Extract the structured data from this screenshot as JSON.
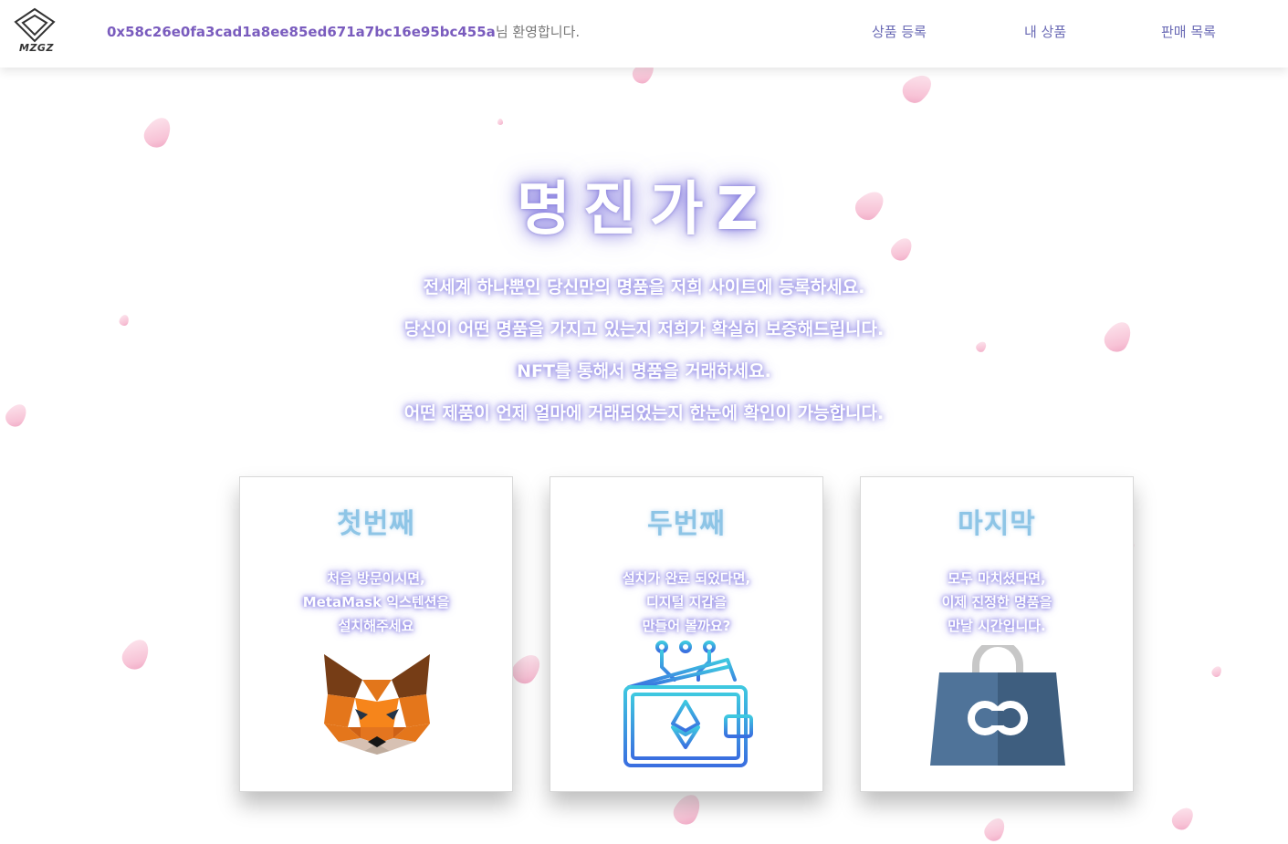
{
  "header": {
    "logo_text": "MZGZ",
    "wallet_address": "0x58c26e0fa3cad1a8ee85ed671a7bc16e95bc455a",
    "welcome_suffix": "님 환영합니다.",
    "nav": [
      "상품 등록",
      "내 상품",
      "판매 목록"
    ]
  },
  "hero": {
    "title": "명진가Z",
    "lines": [
      "전세계 하나뿐인 당신만의 명품을 저희 사이트에 등록하세요.",
      "당신이 어떤 명품을 가지고 있는지 저희가 확실히 보증해드립니다.",
      "NFT를 통해서 명품을 거래하세요.",
      "어떤 제품이 언제 얼마에 거래되었는지 한눈에 확인이 가능합니다."
    ]
  },
  "cards": [
    {
      "title": "첫번째",
      "desc": [
        "처음 방문이시면,",
        "MetaMask 익스텐션을",
        "설치해주세요"
      ],
      "icon": "metamask-fox-icon"
    },
    {
      "title": "두번째",
      "desc": [
        "설치가 완료 되었다면,",
        "디지털 지갑을",
        "만들어 볼까요?"
      ],
      "icon": "crypto-wallet-icon"
    },
    {
      "title": "마지막",
      "desc": [
        "모두 마치셨다면,",
        "이제 진정한 명품을",
        "만날 시간입니다."
      ],
      "icon": "shopping-bag-icon"
    }
  ],
  "colors": {
    "accent": "#6a6ab5",
    "address": "#7a5cbe",
    "card_title": "#8ec5e6",
    "petal": "#f6b8cf"
  }
}
